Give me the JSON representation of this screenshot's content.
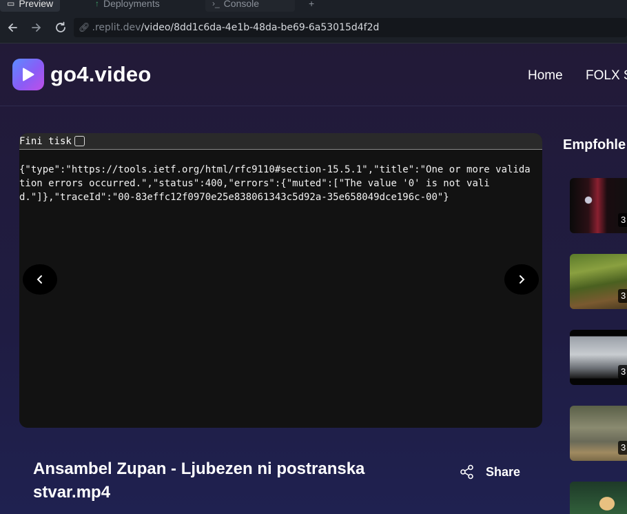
{
  "browser": {
    "tabs": [
      {
        "label": "Preview",
        "icon": "monitor-icon"
      },
      {
        "label": "Deployments",
        "icon": "arrow-up-icon"
      },
      {
        "label": "Console",
        "icon": "terminal-icon"
      }
    ],
    "new_tab": "+",
    "url_domain": ".replit.dev",
    "url_path": "/video/8dd1c6da-4e1b-48da-be69-6a53015d4f2d"
  },
  "site": {
    "logo_text": "go4.video",
    "nav": [
      "Home",
      "FOLX S"
    ]
  },
  "player": {
    "toolbar_label": "Fini tisk",
    "error_text": "{\"type\":\"https://tools.ietf.org/html/rfc9110#section-15.5.1\",\"title\":\"One or more validation errors occurred.\",\"status\":400,\"errors\":{\"muted\":[\"The value '0' is not valid.\"]},\"traceId\":\"00-83effc12f0970e25e838061343c5d92a-35e658049dce196c-00\"}",
    "prev_icon": "chevron-left-icon",
    "next_icon": "chevron-right-icon"
  },
  "video": {
    "title": "Ansambel Zupan - Ljubezen ni postranska stvar.mp4",
    "share_label": "Share"
  },
  "recommended": {
    "heading": "Empfohle",
    "items": [
      {
        "duration": "3"
      },
      {
        "duration": "3"
      },
      {
        "duration": "3"
      },
      {
        "duration": "3"
      },
      {
        "duration": ""
      }
    ]
  },
  "colors": {
    "background": "#1e1b3a",
    "player_bg": "#121212",
    "logo_gradient_start": "#5b8cff",
    "logo_gradient_end": "#c04fe8"
  }
}
